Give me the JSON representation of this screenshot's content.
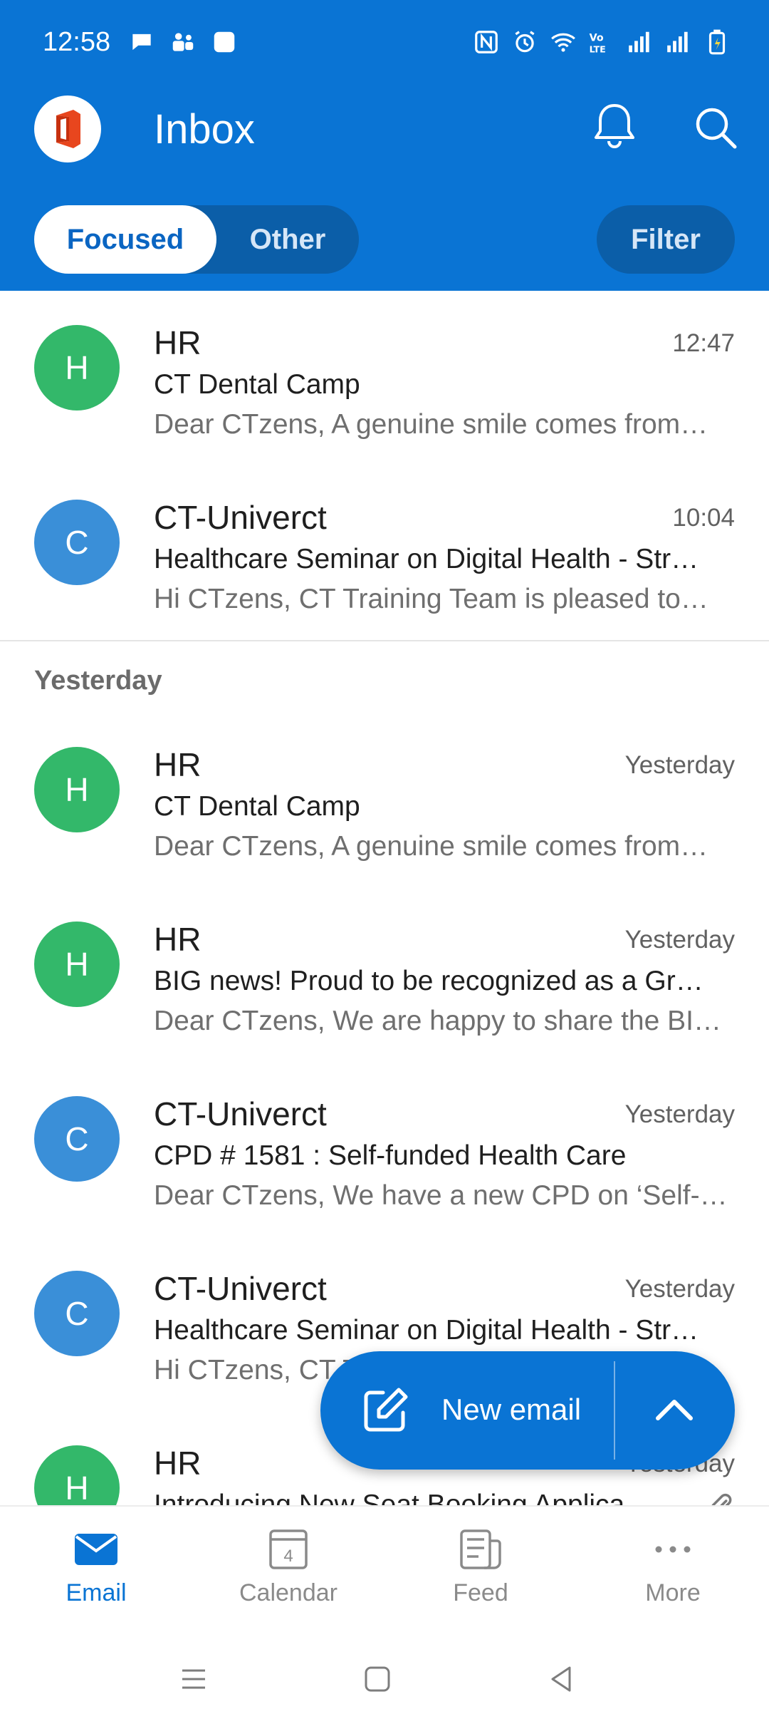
{
  "status_bar": {
    "time": "12:58",
    "left_icons": [
      "chat-bubble-icon",
      "teams-icon",
      "app-square-icon"
    ],
    "right_icons": [
      "nfc-icon",
      "alarm-icon",
      "wifi-icon",
      "volte-icon",
      "signal-icon",
      "signal-icon",
      "battery-charging-icon"
    ]
  },
  "header": {
    "title": "Inbox",
    "tabs": {
      "focused": "Focused",
      "other": "Other"
    },
    "filter_label": "Filter",
    "colors": {
      "brand": "#0a74d4",
      "pill": "#0b5ea8"
    }
  },
  "mail_list": {
    "today": [
      {
        "initial": "H",
        "sender": "HR",
        "time": "12:47",
        "subject": "CT Dental Camp",
        "preview": "Dear CTzens, A genuine smile comes from…",
        "avatar_color": "#33b86a"
      },
      {
        "initial": "C",
        "sender": "CT-Univerct",
        "time": "10:04",
        "subject": "Healthcare Seminar on Digital Health - Str…",
        "preview": "Hi CTzens, CT Training Team is pleased to…",
        "avatar_color": "#3a8fd8"
      }
    ],
    "section_label": "Yesterday",
    "yesterday": [
      {
        "initial": "H",
        "sender": "HR",
        "time": "Yesterday",
        "subject": "CT Dental Camp",
        "preview": "Dear CTzens, A genuine smile comes from…",
        "avatar_color": "#33b86a"
      },
      {
        "initial": "H",
        "sender": "HR",
        "time": "Yesterday",
        "subject": "BIG news! Proud to be recognized as a Gr…",
        "preview": "Dear CTzens, We are happy to share the BI…",
        "avatar_color": "#33b86a"
      },
      {
        "initial": "C",
        "sender": "CT-Univerct",
        "time": "Yesterday",
        "subject": "CPD # 1581 : Self-funded Health Care",
        "preview": "Dear CTzens, We have a new CPD on ‘Self-…",
        "avatar_color": "#3a8fd8"
      },
      {
        "initial": "C",
        "sender": "CT-Univerct",
        "time": "Yesterday",
        "subject": "Healthcare Seminar on Digital Health - Str…",
        "preview": "Hi CTzens, CT Training Team is pleased to…",
        "avatar_color": "#3a8fd8"
      },
      {
        "initial": "H",
        "sender": "HR",
        "time": "Yesterday",
        "subject": "Introducing New Seat Booking Applica…",
        "preview": "",
        "avatar_color": "#33b86a"
      }
    ]
  },
  "fab": {
    "label": "New email"
  },
  "bottom_nav": {
    "items": [
      {
        "label": "Email",
        "icon": "mail-icon",
        "active": true
      },
      {
        "label": "Calendar",
        "icon": "calendar-icon",
        "badge": "4",
        "active": false
      },
      {
        "label": "Feed",
        "icon": "feed-icon",
        "active": false
      },
      {
        "label": "More",
        "icon": "more-dots-icon",
        "active": false
      }
    ]
  },
  "system_nav": [
    "menu-icon",
    "home-icon",
    "back-icon"
  ]
}
